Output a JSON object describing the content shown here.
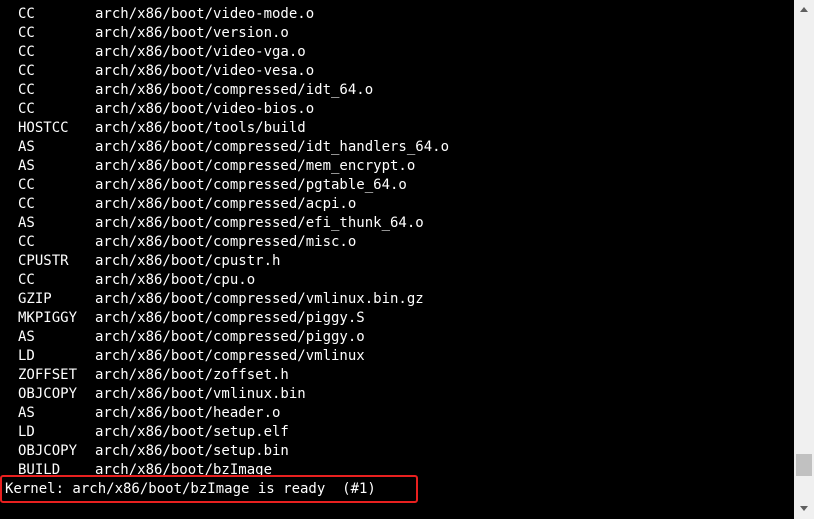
{
  "terminal": {
    "lines": [
      {
        "tool": "CC",
        "path": "arch/x86/boot/video-mode.o"
      },
      {
        "tool": "CC",
        "path": "arch/x86/boot/version.o"
      },
      {
        "tool": "CC",
        "path": "arch/x86/boot/video-vga.o"
      },
      {
        "tool": "CC",
        "path": "arch/x86/boot/video-vesa.o"
      },
      {
        "tool": "CC",
        "path": "arch/x86/boot/compressed/idt_64.o"
      },
      {
        "tool": "CC",
        "path": "arch/x86/boot/video-bios.o"
      },
      {
        "tool": "HOSTCC",
        "path": "arch/x86/boot/tools/build"
      },
      {
        "tool": "AS",
        "path": "arch/x86/boot/compressed/idt_handlers_64.o"
      },
      {
        "tool": "AS",
        "path": "arch/x86/boot/compressed/mem_encrypt.o"
      },
      {
        "tool": "CC",
        "path": "arch/x86/boot/compressed/pgtable_64.o"
      },
      {
        "tool": "CC",
        "path": "arch/x86/boot/compressed/acpi.o"
      },
      {
        "tool": "AS",
        "path": "arch/x86/boot/compressed/efi_thunk_64.o"
      },
      {
        "tool": "CC",
        "path": "arch/x86/boot/compressed/misc.o"
      },
      {
        "tool": "CPUSTR",
        "path": "arch/x86/boot/cpustr.h"
      },
      {
        "tool": "CC",
        "path": "arch/x86/boot/cpu.o"
      },
      {
        "tool": "GZIP",
        "path": "arch/x86/boot/compressed/vmlinux.bin.gz"
      },
      {
        "tool": "MKPIGGY",
        "path": "arch/x86/boot/compressed/piggy.S"
      },
      {
        "tool": "AS",
        "path": "arch/x86/boot/compressed/piggy.o"
      },
      {
        "tool": "LD",
        "path": "arch/x86/boot/compressed/vmlinux"
      },
      {
        "tool": "ZOFFSET",
        "path": "arch/x86/boot/zoffset.h"
      },
      {
        "tool": "OBJCOPY",
        "path": "arch/x86/boot/vmlinux.bin"
      },
      {
        "tool": "AS",
        "path": "arch/x86/boot/header.o"
      },
      {
        "tool": "LD",
        "path": "arch/x86/boot/setup.elf"
      },
      {
        "tool": "OBJCOPY",
        "path": "arch/x86/boot/setup.bin"
      },
      {
        "tool": "BUILD",
        "path": "arch/x86/boot/bzImage"
      }
    ],
    "final_line": "Kernel: arch/x86/boot/bzImage is ready  (#1)",
    "text_color": "#ffffff",
    "background_color": "#000000",
    "highlight_color": "#e8201f"
  },
  "scrollbar": {
    "up_icon": "triangle-up-icon",
    "down_icon": "triangle-down-icon",
    "position": 0.95
  }
}
